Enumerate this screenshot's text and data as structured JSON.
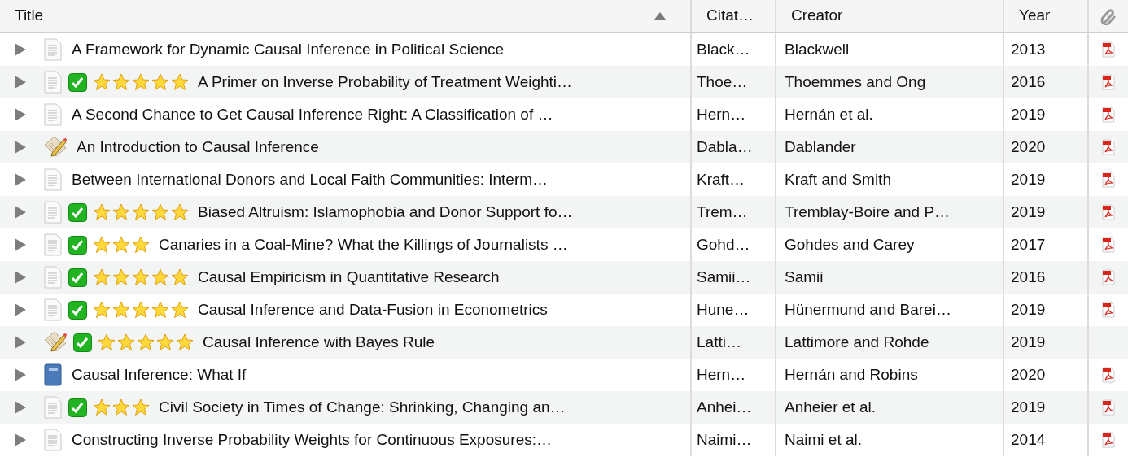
{
  "columns": [
    {
      "label": "Title",
      "sorted": true
    },
    {
      "label": "Citat…"
    },
    {
      "label": "Creator"
    },
    {
      "label": "Year"
    }
  ],
  "rows": [
    {
      "kind": "document",
      "done": false,
      "title": "A Framework for Dynamic Causal Inference in Political Science",
      "citation": "Black…",
      "creator": "Blackwell",
      "year": "2013",
      "pdf": true
    },
    {
      "kind": "document",
      "done": true,
      "stars": 5,
      "title": "A Primer on Inverse Probability of Treatment Weighti…",
      "citation": "Thoe…",
      "creator": "Thoemmes and Ong",
      "year": "2016",
      "pdf": true
    },
    {
      "kind": "document",
      "done": false,
      "title": "A Second Chance to Get Causal Inference Right: A Classification of …",
      "citation": "Hern…",
      "creator": "Hernán et al.",
      "year": "2019",
      "pdf": true
    },
    {
      "kind": "note",
      "done": false,
      "title": "An Introduction to Causal Inference",
      "citation": "Dabla…",
      "creator": "Dablander",
      "year": "2020",
      "pdf": true
    },
    {
      "kind": "document",
      "done": false,
      "title": "Between International Donors and Local Faith Communities: Interm…",
      "citation": "Kraft…",
      "creator": "Kraft and Smith",
      "year": "2019",
      "pdf": true
    },
    {
      "kind": "document",
      "done": true,
      "stars": 5,
      "title": "Biased Altruism: Islamophobia and Donor Support fo…",
      "citation": "Trem…",
      "creator": "Tremblay-Boire and P…",
      "year": "2019",
      "pdf": true
    },
    {
      "kind": "document",
      "done": true,
      "stars": 3,
      "title": "Canaries in a Coal-Mine? What the Killings of Journalists …",
      "citation": "Gohd…",
      "creator": "Gohdes and Carey",
      "year": "2017",
      "pdf": true
    },
    {
      "kind": "document",
      "done": true,
      "stars": 5,
      "title": "Causal Empiricism in Quantitative Research",
      "citation": "Samii…",
      "creator": "Samii",
      "year": "2016",
      "pdf": true
    },
    {
      "kind": "document",
      "done": true,
      "stars": 5,
      "title": "Causal Inference and Data-Fusion in Econometrics",
      "citation": "Hune…",
      "creator": "Hünermund and Barei…",
      "year": "2019",
      "pdf": true
    },
    {
      "kind": "note",
      "done": true,
      "stars": 5,
      "title": "Causal Inference with Bayes Rule",
      "citation": "Latti…",
      "creator": "Lattimore and Rohde",
      "year": "2019",
      "pdf": false
    },
    {
      "kind": "book",
      "done": false,
      "title": "Causal Inference: What If",
      "citation": "Hern…",
      "creator": "Hernán and Robins",
      "year": "2020",
      "pdf": true
    },
    {
      "kind": "document",
      "done": true,
      "stars": 3,
      "title": "Civil Society in Times of Change: Shrinking, Changing an…",
      "citation": "Anhei…",
      "creator": "Anheier et al.",
      "year": "2019",
      "pdf": true
    },
    {
      "kind": "document",
      "done": false,
      "title": "Constructing Inverse Probability Weights for Continuous Exposures:…",
      "citation": "Naimi…",
      "creator": "Naimi et al.",
      "year": "2014",
      "pdf": true
    }
  ]
}
